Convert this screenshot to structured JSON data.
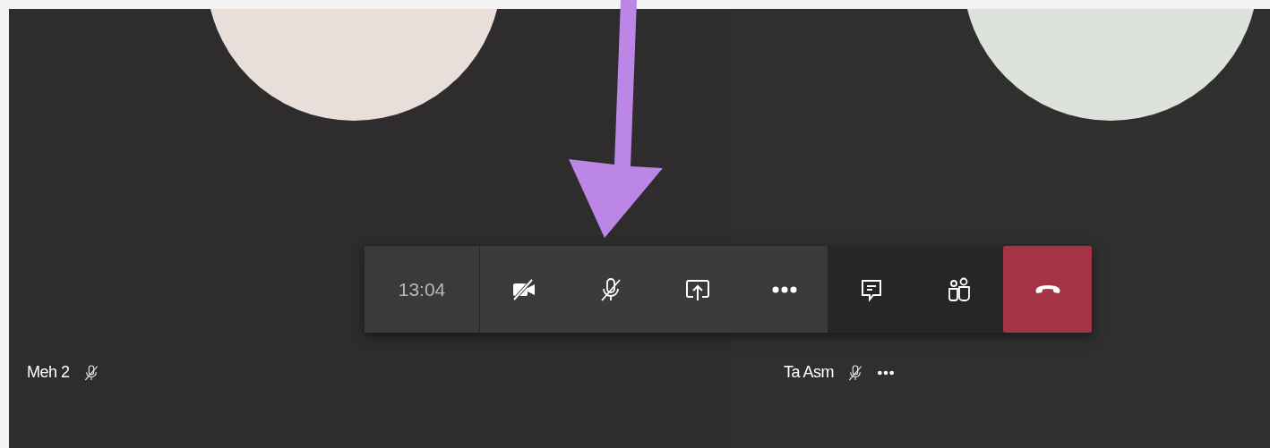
{
  "participants": [
    {
      "name": "Meh 2",
      "muted": true,
      "show_more": false,
      "color": "#e9dfda"
    },
    {
      "name": "Ta Asm",
      "muted": true,
      "show_more": true,
      "color": "#dde2da"
    }
  ],
  "call_toolbar": {
    "time": "13:04",
    "controls": [
      {
        "kind": "camera_off"
      },
      {
        "kind": "mic_off"
      },
      {
        "kind": "share"
      },
      {
        "kind": "more"
      }
    ],
    "panels": [
      {
        "kind": "chat"
      },
      {
        "kind": "people"
      }
    ],
    "end_call": {
      "kind": "hangup"
    }
  },
  "annotation": {
    "kind": "arrow"
  }
}
